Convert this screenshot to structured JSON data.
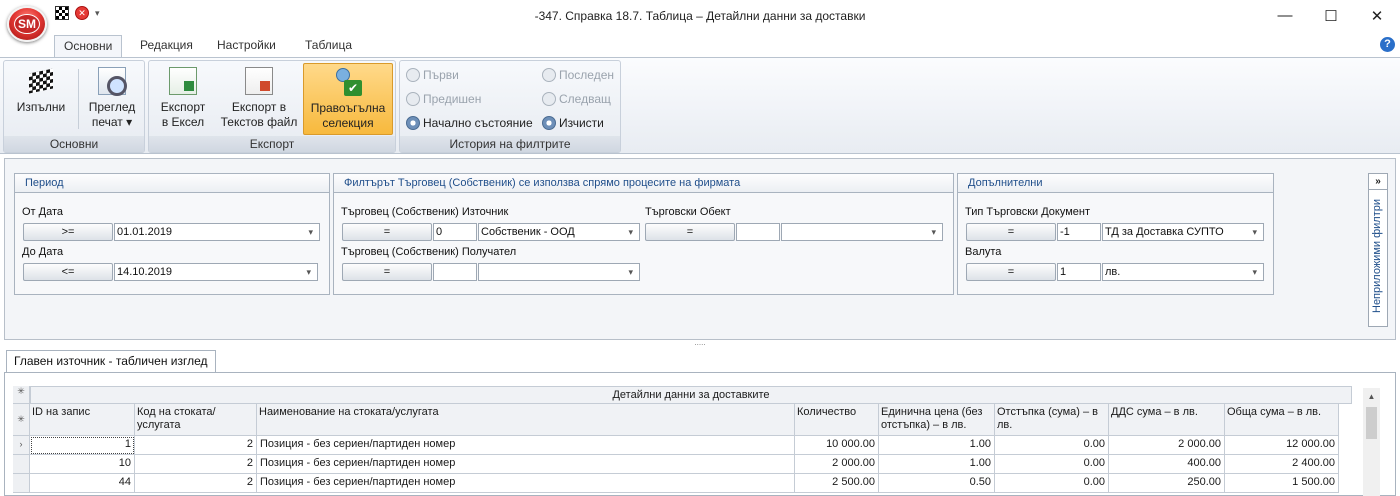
{
  "window": {
    "title": "-347. Справка 18.7. Таблица – Детайлни данни за доставки",
    "minimize": "—",
    "maximize": "☐",
    "close": "✕"
  },
  "app": {
    "orb_label": "SM",
    "qat_dropdown": "▾"
  },
  "ribbon": {
    "tabs": [
      "Основни",
      "Редакция",
      "Настройки",
      "Таблица"
    ],
    "help": "?",
    "groups": {
      "osnovni": {
        "label": "Основни",
        "run": "Изпълни",
        "preview_line1": "Преглед",
        "preview_line2": "печат ▾"
      },
      "export": {
        "label": "Експорт",
        "excel_line1": "Експорт",
        "excel_line2": "в Ексел",
        "text_line1": "Експорт в",
        "text_line2": "Текстов файл",
        "rect_line1": "Правоъгълна",
        "rect_line2": "селекция"
      },
      "history": {
        "label": "История на филтрите",
        "first": "Първи",
        "last": "Последен",
        "prev": "Предишен",
        "next": "Следващ",
        "initial": "Начално състояние",
        "clear": "Изчисти"
      }
    }
  },
  "filters": {
    "period": {
      "title": "Период",
      "from_label": "От Дата",
      "from_op": ">=",
      "from_value": "01.01.2019",
      "to_label": "До Дата",
      "to_op": "<=",
      "to_value": "14.10.2019"
    },
    "trader": {
      "title": "Филтърът Търговец (Собственик) се използва спрямо процесите на фирмата",
      "source_label": "Търговец (Собственик) Източник",
      "source_op": "=",
      "source_code": "0",
      "source_value": "Собственик - ООД",
      "object_label": "Търговски Обект",
      "object_op": "=",
      "object_code": "",
      "object_value": "",
      "receiver_label": "Търговец (Собственик) Получател",
      "receiver_op": "=",
      "receiver_code": "",
      "receiver_value": ""
    },
    "additional": {
      "title": "Допълнителни",
      "doc_label": "Тип Търговски Документ",
      "doc_op": "=",
      "doc_code": "-1",
      "doc_value": "ТД за Доставка СУПТО",
      "currency_label": "Валута",
      "currency_op": "=",
      "currency_code": "1",
      "currency_value": "лв."
    },
    "side_tab": {
      "expand": "»",
      "label": "Неприложими филтри"
    }
  },
  "grid_tab": "Главен източник - табличен изглед",
  "table": {
    "band": "Детайлни данни за доставките",
    "columns": [
      "ID на запис",
      "Код на стоката/услугата",
      "Наименование на стоката/услугата",
      "Количество",
      "Единична цена (без отстъпка) – в лв.",
      "Отстъпка (сума) – в лв.",
      "ДДС сума – в лв.",
      "Обща сума – в лв."
    ],
    "rows": [
      [
        "1",
        "2",
        "Позиция - без сериен/партиден номер",
        "10 000.00",
        "1.00",
        "0.00",
        "2 000.00",
        "12 000.00"
      ],
      [
        "10",
        "2",
        "Позиция - без сериен/партиден номер",
        "2 000.00",
        "1.00",
        "0.00",
        "400.00",
        "2 400.00"
      ],
      [
        "44",
        "2",
        "Позиция - без сериен/партиден номер",
        "2 500.00",
        "0.50",
        "0.00",
        "250.00",
        "1 500.00"
      ]
    ]
  }
}
